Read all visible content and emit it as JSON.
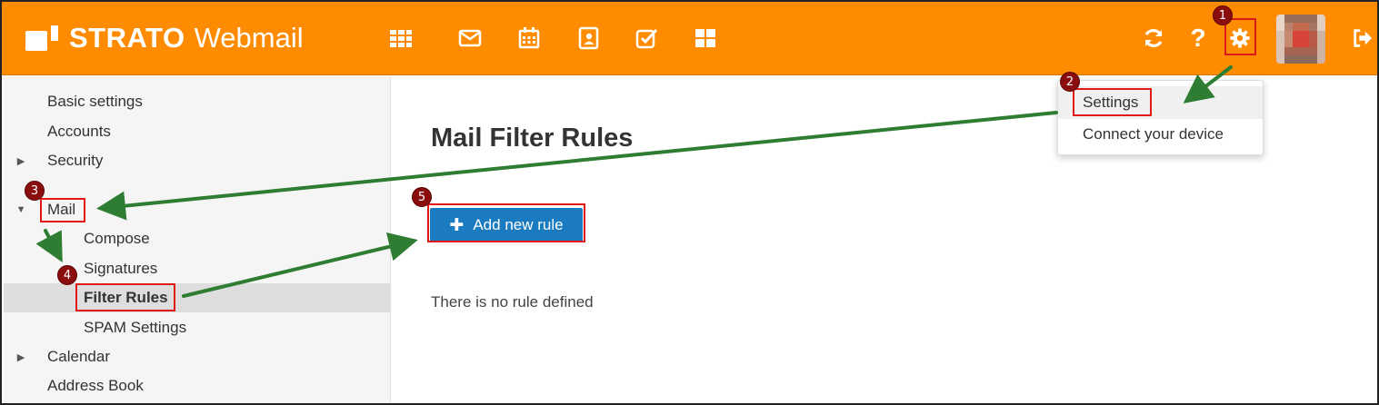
{
  "header": {
    "logo_strong": "STRATO",
    "logo_light": "Webmail",
    "apps": [
      {
        "name": "apps-grid-icon"
      },
      {
        "name": "mail-icon"
      },
      {
        "name": "calendar-icon"
      },
      {
        "name": "contacts-icon"
      },
      {
        "name": "tasks-icon"
      },
      {
        "name": "drive-icon"
      }
    ],
    "right_icons": [
      "refresh-icon",
      "help-icon",
      "settings-gear-icon",
      "user-avatar",
      "logout-icon"
    ],
    "help_glyph": "?"
  },
  "sidebar": {
    "items": [
      {
        "label": "Basic settings"
      },
      {
        "label": "Accounts"
      },
      {
        "label": "Security"
      },
      {
        "label": "Mail"
      },
      {
        "label": "Compose"
      },
      {
        "label": "Signatures"
      },
      {
        "label": "Filter Rules"
      },
      {
        "label": "SPAM Settings"
      },
      {
        "label": "Calendar"
      },
      {
        "label": "Address Book"
      }
    ]
  },
  "main": {
    "title": "Mail Filter Rules",
    "add_button": "Add new rule",
    "empty_message": "There is no rule defined"
  },
  "dropdown": {
    "items": [
      {
        "label": "Settings"
      },
      {
        "label": "Connect your device"
      }
    ]
  },
  "annotations": {
    "badges": [
      "1",
      "2",
      "3",
      "4",
      "5"
    ]
  },
  "colors": {
    "header": "#ff8c00",
    "button": "#1a7bc0",
    "highlight": "#e01818",
    "badge": "#8b0e0e",
    "arrow": "#2e7d32"
  }
}
